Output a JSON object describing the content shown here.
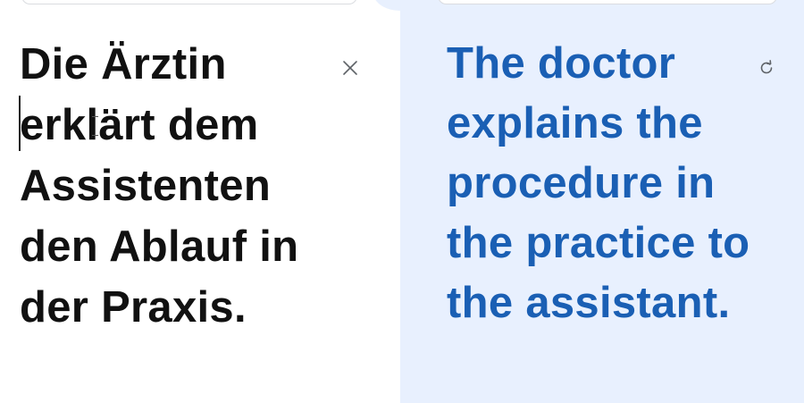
{
  "source": {
    "text": "Die Ärztin erklärt dem Assistenten den Ablauf in der Praxis."
  },
  "target": {
    "text": "The doctor explains the procedure in the practice to the assistant."
  },
  "icons": {
    "clear": "close-icon",
    "refresh": "refresh-icon",
    "cursor": "text-cursor-icon"
  },
  "colors": {
    "source_text": "#111111",
    "target_text": "#1a5fb4",
    "target_background": "#e8f0fe",
    "icon": "#5f6368"
  }
}
